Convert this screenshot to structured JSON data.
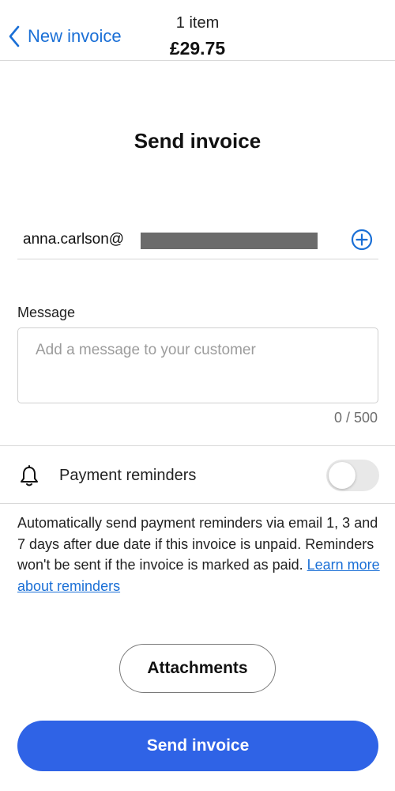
{
  "header": {
    "back_label": "New invoice",
    "item_count": "1 item",
    "total": "£29.75"
  },
  "title": "Send invoice",
  "recipient": {
    "email_visible": "anna.carlson@"
  },
  "message": {
    "label": "Message",
    "placeholder": "Add a message to your customer",
    "value": "",
    "counter": "0 / 500"
  },
  "reminders": {
    "label": "Payment reminders",
    "enabled": false,
    "description": "Automatically send payment reminders via email 1, 3 and 7 days after due date if this invoice is unpaid. Reminders won't be sent if the invoice is marked as paid. ",
    "link_text": "Learn more about reminders"
  },
  "buttons": {
    "attachments": "Attachments",
    "send": "Send invoice"
  },
  "colors": {
    "accent_link": "#1a6fd6",
    "primary_button": "#2f63e6",
    "toggle_off": "#e8e8e8",
    "redaction": "#6b6b6b"
  },
  "icons": {
    "back": "chevron-left-icon",
    "add_recipient": "plus-circle-icon",
    "reminders": "bell-icon"
  }
}
